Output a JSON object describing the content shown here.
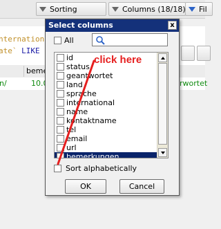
{
  "toolbar": {
    "sorting_label": "Sorting",
    "columns_label": "Columns (18/18)",
    "filter_label": "Fil"
  },
  "editor": {
    "line1_a": "nternation",
    "line2_a": "ate`",
    "line2_kw": "LIKE"
  },
  "grid": {
    "header_col1": "",
    "header_col2": "beme",
    "row_col1": "n/",
    "row_col2": "10.0",
    "row_right": "rwortet"
  },
  "dialog": {
    "title": "Select columns",
    "close_glyph": "x",
    "all_label": "All",
    "search_placeholder": "",
    "columns": [
      {
        "label": "id",
        "checked": false,
        "selected": false
      },
      {
        "label": "status",
        "checked": false,
        "selected": false
      },
      {
        "label": "geantwortet",
        "checked": false,
        "selected": false
      },
      {
        "label": "land",
        "checked": false,
        "selected": false
      },
      {
        "label": "sprache",
        "checked": false,
        "selected": false
      },
      {
        "label": "international",
        "checked": false,
        "selected": false
      },
      {
        "label": "name",
        "checked": false,
        "selected": false
      },
      {
        "label": "kontaktname",
        "checked": false,
        "selected": false
      },
      {
        "label": "tel",
        "checked": false,
        "selected": false
      },
      {
        "label": "email",
        "checked": false,
        "selected": false
      },
      {
        "label": "url",
        "checked": false,
        "selected": false
      },
      {
        "label": "bemerkungen",
        "checked": false,
        "selected": true
      }
    ],
    "sort_label": "Sort alphabetically",
    "ok_label": "OK",
    "cancel_label": "Cancel"
  },
  "annotation": {
    "text": "click here",
    "color": "#e61f1f"
  }
}
